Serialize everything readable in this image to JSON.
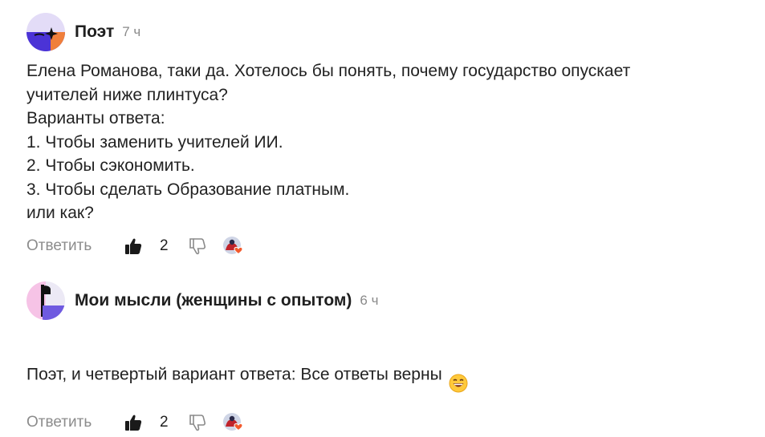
{
  "comments": [
    {
      "author": "Поэт",
      "time": "7 ч",
      "text": "Елена Романова, таки да. Хотелось бы понять, почему государство опускает\nучителей ниже плинтуса?\nВарианты ответа:\n1. Чтобы заменить учителей ИИ.\n2. Чтобы сэкономить.\n3. Чтобы сделать Образование платным.\nили как?",
      "reply_label": "Ответить",
      "likes": "2"
    },
    {
      "author": "Мои мысли (женщины с опытом)",
      "time": "6 ч",
      "text": "Поэт, и четвертый вариант ответа: Все ответы верны",
      "reply_label": "Ответить",
      "likes": "2"
    }
  ],
  "colors": {
    "avatar1_top": "#e3dcf7",
    "avatar1_bottom": "#4b33d6",
    "avatar1_accent": "#f07f3b",
    "avatar2_pink": "#f6c3e6",
    "avatar2_purple": "#6f5ae0",
    "reaction_heart": "#f25a2d"
  },
  "icons": {
    "like": "thumb-up-icon",
    "dislike": "thumb-down-icon",
    "reactions": "reaction-avatar-heart-icon",
    "text_emoji": "grinning-face-emoji"
  }
}
